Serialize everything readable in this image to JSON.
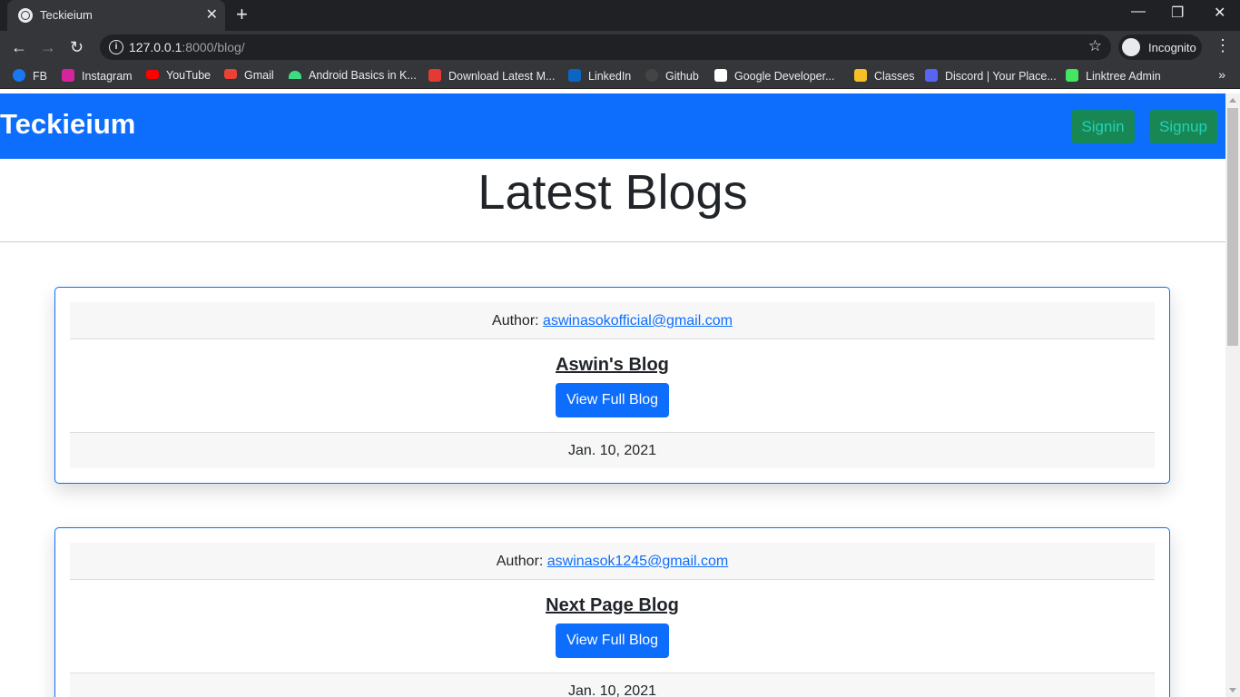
{
  "browser": {
    "tab_title": "Teckieium",
    "url_host": "127.0.0.1",
    "url_path": ":8000/blog/",
    "incognito_label": "Incognito",
    "bookmarks": [
      {
        "label": "FB",
        "color": "#1877f2"
      },
      {
        "label": "Instagram",
        "color": "#d6249f"
      },
      {
        "label": "YouTube",
        "color": "#ff0000"
      },
      {
        "label": "Gmail",
        "color": "#ea4335"
      },
      {
        "label": "Android Basics in K...",
        "color": "#3ddc84"
      },
      {
        "label": "Download Latest M...",
        "color": "#e53935"
      },
      {
        "label": "LinkedIn",
        "color": "#0a66c2"
      },
      {
        "label": "Github",
        "color": "#444444"
      },
      {
        "label": "Google Developer...",
        "color": "#ffffff"
      },
      {
        "label": "Classes",
        "color": "#f6c026"
      },
      {
        "label": "Discord | Your Place...",
        "color": "#5865f2"
      },
      {
        "label": "Linktree Admin",
        "color": "#43e660"
      }
    ]
  },
  "navbar": {
    "brand": "Teckieium",
    "signin_label": "Signin",
    "signup_label": "Signup"
  },
  "main": {
    "heading": "Latest Blogs",
    "blogs": [
      {
        "author_prefix": "Author: ",
        "author_email": "aswinasokofficial@gmail.com",
        "title": "Aswin's Blog",
        "button_label": "View Full Blog",
        "date": "Jan. 10, 2021"
      },
      {
        "author_prefix": "Author: ",
        "author_email": "aswinasok1245@gmail.com",
        "title": "Next Page Blog",
        "button_label": "View Full Blog",
        "date": "Jan. 10, 2021"
      }
    ]
  }
}
